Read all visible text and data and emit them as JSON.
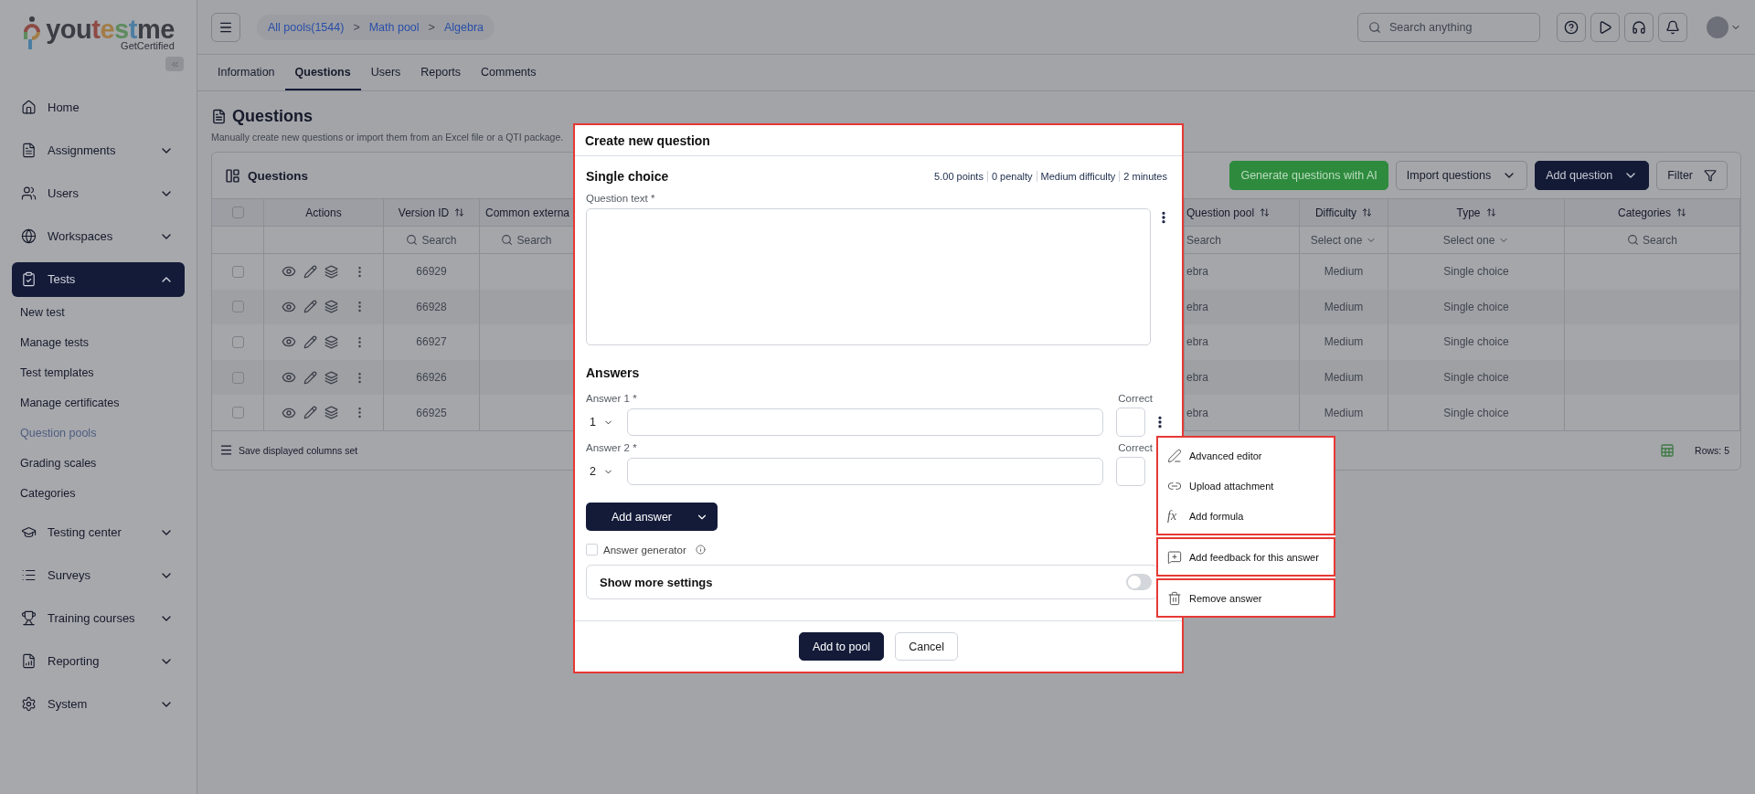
{
  "sidebar": {
    "logo": {
      "parts": [
        {
          "text": "you",
          "color": "#3b3d44"
        },
        {
          "text": "t",
          "color": "#8e4a44"
        },
        {
          "text": "e",
          "color": "#a27c46"
        },
        {
          "text": "s",
          "color": "#5e8b5e"
        },
        {
          "text": "t",
          "color": "#4d7ea2"
        },
        {
          "text": "me",
          "color": "#3b3d44"
        }
      ],
      "tagline": "GetCertified"
    },
    "items": [
      {
        "label": "Home",
        "kind": "link",
        "selected": false
      },
      {
        "label": "Assignments",
        "kind": "group",
        "expanded": false,
        "selected": false
      },
      {
        "label": "Users",
        "kind": "group",
        "expanded": false,
        "selected": false
      },
      {
        "label": "Workspaces",
        "kind": "group",
        "expanded": false,
        "selected": false
      },
      {
        "label": "Tests",
        "kind": "group",
        "expanded": true,
        "selected": true,
        "children": [
          {
            "label": "New test",
            "selected": false
          },
          {
            "label": "Manage tests",
            "selected": false
          },
          {
            "label": "Test templates",
            "selected": false
          },
          {
            "label": "Manage certificates",
            "selected": false
          },
          {
            "label": "Question pools",
            "selected": true
          },
          {
            "label": "Grading scales",
            "selected": false
          },
          {
            "label": "Categories",
            "selected": false
          }
        ]
      },
      {
        "label": "Testing center",
        "kind": "group",
        "expanded": false,
        "selected": false
      },
      {
        "label": "Surveys",
        "kind": "group",
        "expanded": false,
        "selected": false
      },
      {
        "label": "Training courses",
        "kind": "group",
        "expanded": false,
        "selected": false
      },
      {
        "label": "Reporting",
        "kind": "group",
        "expanded": false,
        "selected": false
      },
      {
        "label": "System",
        "kind": "group",
        "expanded": false,
        "selected": false
      }
    ]
  },
  "topbar": {
    "breadcrumb": [
      {
        "label": "All pools(1544)",
        "kind": "link"
      },
      {
        "label": ">",
        "kind": "separator"
      },
      {
        "label": "Math pool",
        "kind": "link"
      },
      {
        "label": ">",
        "kind": "separator"
      },
      {
        "label": "Algebra",
        "kind": "link"
      }
    ],
    "search": {
      "placeholder": "Search anything"
    }
  },
  "tabs": [
    {
      "label": "Information",
      "selected": false
    },
    {
      "label": "Questions",
      "selected": true
    },
    {
      "label": "Users",
      "selected": false
    },
    {
      "label": "Reports",
      "selected": false
    },
    {
      "label": "Comments",
      "selected": false
    }
  ],
  "page": {
    "title": "Questions",
    "description": "Manually create new questions or import them from an Excel file or a QTI package."
  },
  "card": {
    "title": "Questions",
    "buttons": [
      {
        "label": "Generate questions with AI",
        "kind": "ai"
      },
      {
        "label": "Import questions",
        "kind": "outline"
      },
      {
        "label": "Add question",
        "kind": "primary"
      },
      {
        "label": "Filter",
        "kind": "filter"
      }
    ]
  },
  "table": {
    "select_all_checked": false,
    "columns": [
      {
        "label": "Actions",
        "sortable": false
      },
      {
        "label": "Version ID",
        "sortable": true
      },
      {
        "label": "Common externa"
      },
      {
        "label": "Question pool",
        "sortable": true
      },
      {
        "label": "Difficulty",
        "sortable": true
      },
      {
        "label": "Type",
        "sortable": true
      },
      {
        "label": "Categories",
        "sortable": true
      }
    ],
    "filters": [
      {
        "kind": "none"
      },
      {
        "kind": "search",
        "placeholder": "Search"
      },
      {
        "kind": "search",
        "placeholder": "Search"
      },
      {
        "kind": "text",
        "placeholder": "Search"
      },
      {
        "kind": "select",
        "placeholder": "Select one"
      },
      {
        "kind": "select",
        "placeholder": "Select one"
      },
      {
        "kind": "search",
        "placeholder": "Search"
      }
    ],
    "rows": [
      {
        "checked": false,
        "version_id": "66929",
        "question_pool": "ebra",
        "difficulty": "Medium",
        "type": "Single choice"
      },
      {
        "checked": false,
        "version_id": "66928",
        "question_pool": "ebra",
        "difficulty": "Medium",
        "type": "Single choice"
      },
      {
        "checked": false,
        "version_id": "66927",
        "question_pool": "ebra",
        "difficulty": "Medium",
        "type": "Single choice"
      },
      {
        "checked": false,
        "version_id": "66926",
        "question_pool": "ebra",
        "difficulty": "Medium",
        "type": "Single choice"
      },
      {
        "checked": false,
        "version_id": "66925",
        "question_pool": "ebra",
        "difficulty": "Medium",
        "type": "Single choice"
      }
    ],
    "footer": {
      "save_label": "Save displayed columns set",
      "rows_count": "Rows: 5"
    }
  },
  "modal": {
    "title": "Create new question",
    "question_type": "Single choice",
    "meta": [
      "5.00 points",
      "0 penalty",
      "Medium difficulty",
      "2 minutes"
    ],
    "question_label": "Question text *",
    "answers_title": "Answers",
    "answers": [
      {
        "label": "Answer 1 *",
        "order": "1",
        "correct_label": "Correct",
        "correct": false
      },
      {
        "label": "Answer 2 *",
        "order": "2",
        "correct_label": "Correct",
        "correct": false
      }
    ],
    "add_answer": "Add answer",
    "generator": {
      "label": "Answer generator",
      "checked": false
    },
    "more_settings": {
      "label": "Show more settings",
      "on": false
    },
    "buttons": [
      {
        "label": "Add to pool",
        "kind": "primary"
      },
      {
        "label": "Cancel",
        "kind": "secondary"
      }
    ]
  },
  "menu": {
    "sections": [
      {
        "items": [
          {
            "label": "Advanced editor"
          },
          {
            "label": "Upload attachment"
          },
          {
            "label": "Add formula",
            "icon_text": "fx"
          }
        ]
      },
      {
        "items": [
          {
            "label": "Add feedback for this answer"
          }
        ]
      },
      {
        "items": [
          {
            "label": "Remove answer"
          }
        ]
      }
    ]
  }
}
